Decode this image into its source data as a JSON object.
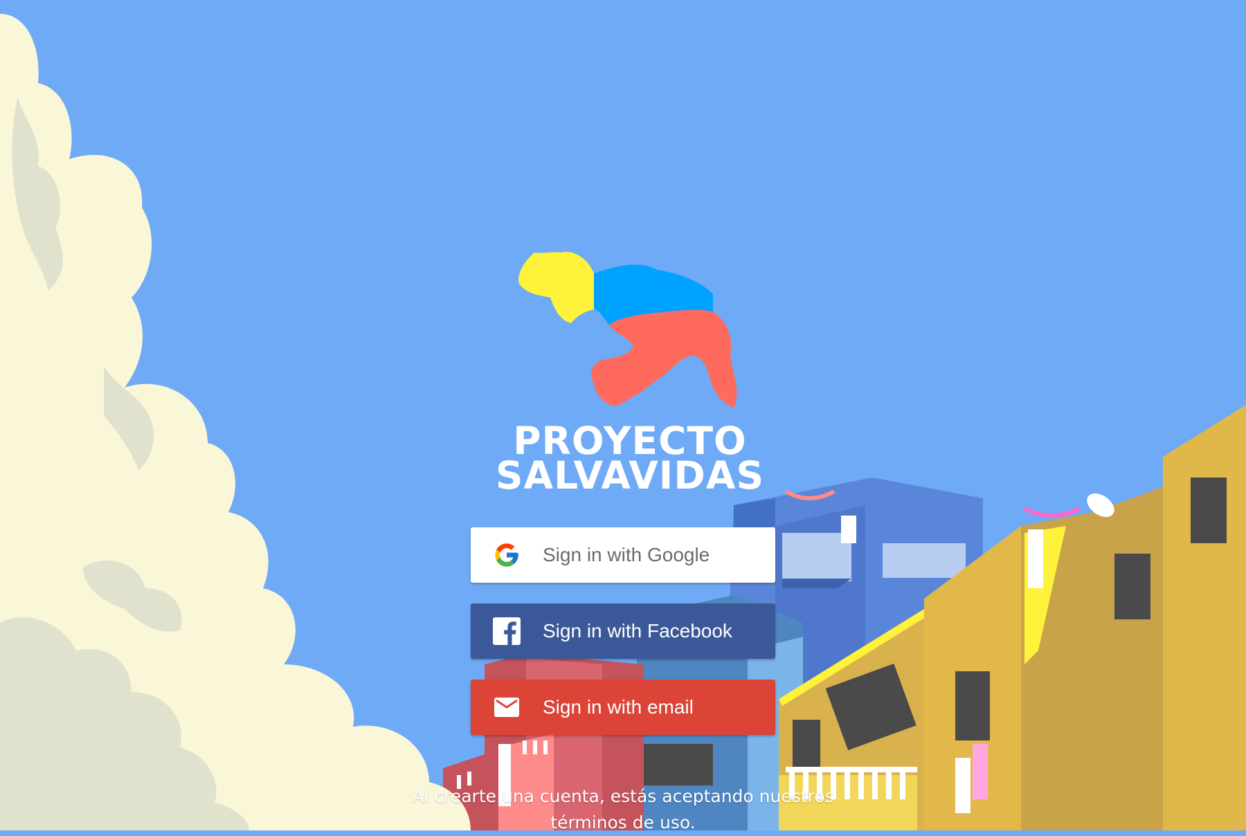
{
  "brand": {
    "line1": "PROYECTO",
    "line2": "SALVAVIDAS",
    "colors": {
      "yellow": "#fff23a",
      "blue": "#00a2ff",
      "red": "#ff6a5e"
    }
  },
  "auth": {
    "google": {
      "label": "Sign in with Google",
      "icon": "google-g-icon"
    },
    "facebook": {
      "label": "Sign in with Facebook",
      "icon": "facebook-f-icon"
    },
    "email": {
      "label": "Sign in with email",
      "icon": "envelope-icon"
    }
  },
  "terms": {
    "text": "Al crearte una cuenta, estás aceptando nuestros términos de uso."
  },
  "colors": {
    "sky": "#6eaaf5",
    "google_bg": "#ffffff",
    "facebook_bg": "#3b5998",
    "email_bg": "#db4437"
  }
}
